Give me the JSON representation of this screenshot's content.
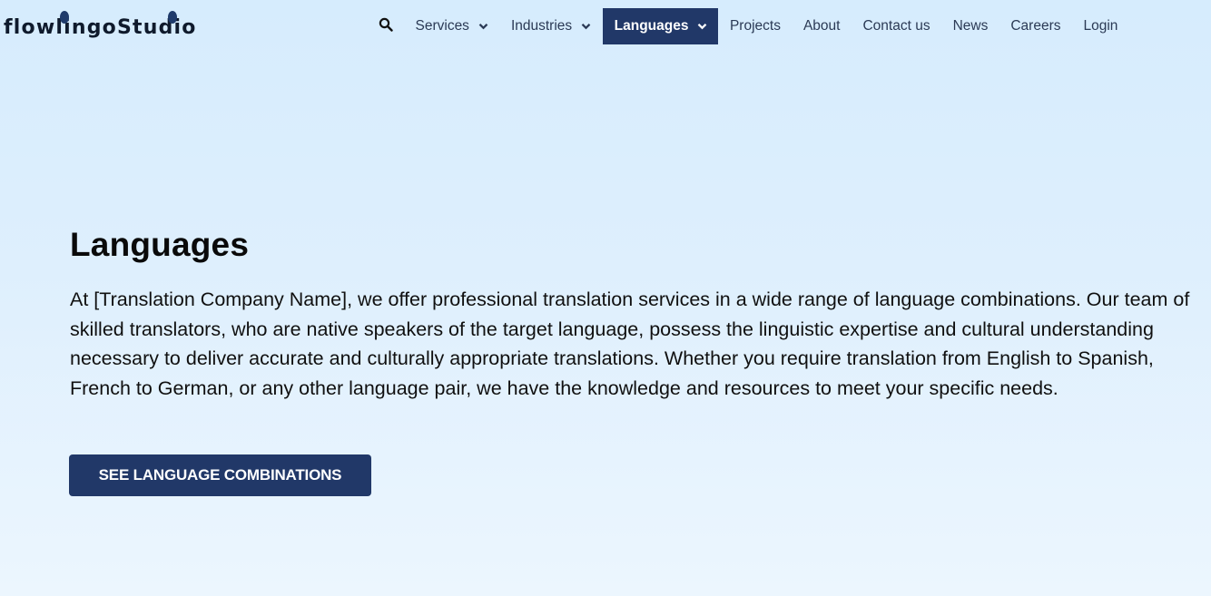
{
  "brand": {
    "logo_text": "flowlingoStudio",
    "logo_color": "#0f1a2c",
    "accent_color": "#213868"
  },
  "nav": {
    "search_icon": "search-icon",
    "items": [
      {
        "label": "Services",
        "has_dropdown": true,
        "active": false
      },
      {
        "label": "Industries",
        "has_dropdown": true,
        "active": false
      },
      {
        "label": "Languages",
        "has_dropdown": true,
        "active": true
      },
      {
        "label": "Projects",
        "has_dropdown": false,
        "active": false
      },
      {
        "label": "About",
        "has_dropdown": false,
        "active": false
      },
      {
        "label": "Contact us",
        "has_dropdown": false,
        "active": false
      },
      {
        "label": "News",
        "has_dropdown": false,
        "active": false
      },
      {
        "label": "Careers",
        "has_dropdown": false,
        "active": false
      },
      {
        "label": "Login",
        "has_dropdown": false,
        "active": false
      }
    ]
  },
  "hero": {
    "title": "Languages",
    "body": "At [Translation Company Name], we offer professional translation services in a wide range of language combinations. Our team of skilled translators, who are native speakers of the target language, possess the linguistic expertise and cultural understanding necessary to deliver accurate and culturally appropriate translations. Whether you require translation from English to Spanish, French to German, or any other language pair, we have the knowledge and resources to meet your specific needs.",
    "cta_label": "SEE LANGUAGE COMBINATIONS"
  }
}
